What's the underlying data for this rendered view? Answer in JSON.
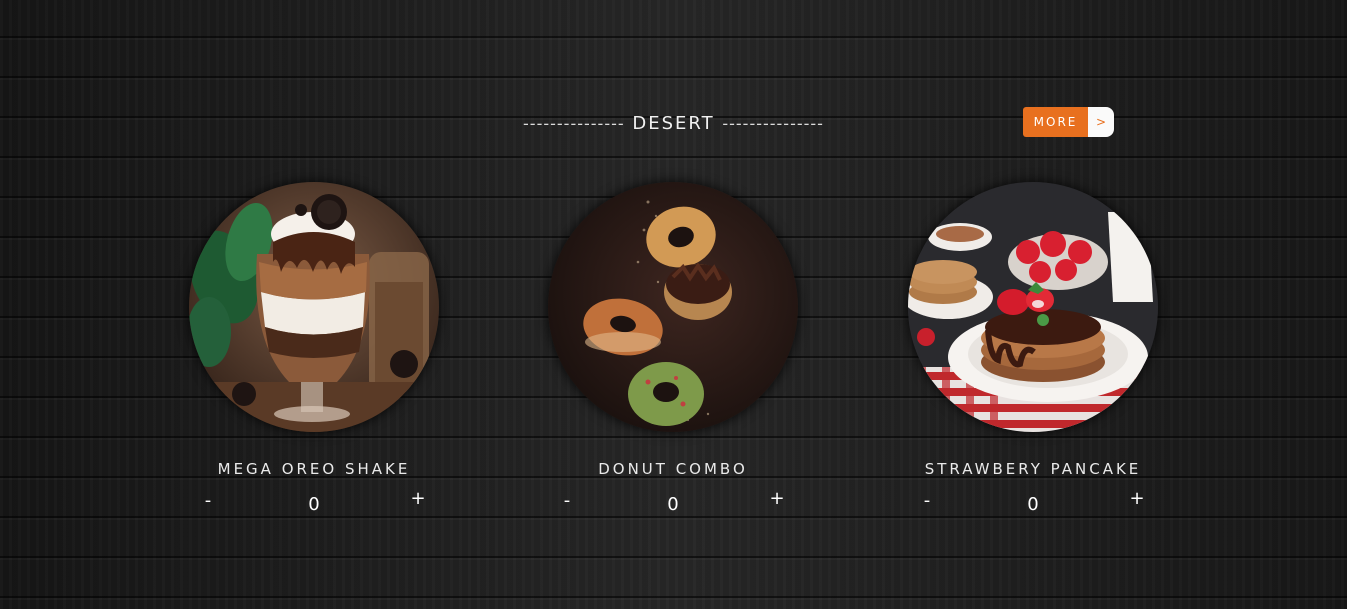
{
  "section": {
    "dashes_left": "---------------",
    "title": "DESERT",
    "dashes_right": "---------------"
  },
  "more_button": {
    "label": "MORE",
    "arrow": ">",
    "color": "#e8701f"
  },
  "items": [
    {
      "name": "MEGA OREO SHAKE",
      "image": "oreo-shake-photo",
      "minus": "-",
      "quantity": "0",
      "plus": "+"
    },
    {
      "name": "DONUT COMBO",
      "image": "donut-combo-photo",
      "minus": "-",
      "quantity": "0",
      "plus": "+"
    },
    {
      "name": "STRAWBERY PANCAKE",
      "image": "strawberry-pancake-photo",
      "minus": "-",
      "quantity": "0",
      "plus": "+"
    }
  ]
}
